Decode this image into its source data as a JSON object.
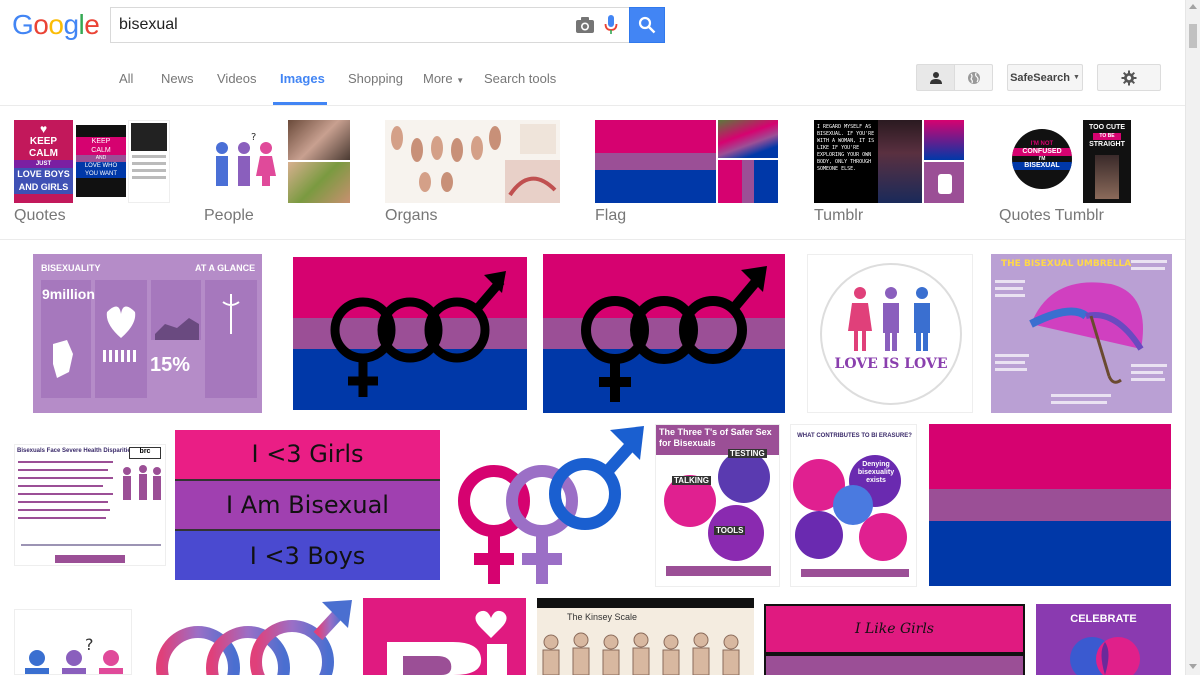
{
  "search": {
    "query": "bisexual"
  },
  "logo": {
    "letters": [
      "G",
      "o",
      "o",
      "g",
      "l",
      "e"
    ],
    "colors": [
      "#4285f4",
      "#ea4335",
      "#fbbc05",
      "#4285f4",
      "#34a853",
      "#ea4335"
    ]
  },
  "nav": {
    "tabs": [
      "All",
      "News",
      "Videos",
      "Images",
      "Shopping",
      "More",
      "Search tools"
    ],
    "active_tab": "Images",
    "safesearch_label": "SafeSearch"
  },
  "related": [
    {
      "label": "Quotes"
    },
    {
      "label": "People"
    },
    {
      "label": "Organs"
    },
    {
      "label": "Flag"
    },
    {
      "label": "Tumblr"
    },
    {
      "label": "Quotes Tumblr"
    }
  ],
  "thumb_text": {
    "keep_calm": [
      "KEEP",
      "CALM",
      "JUST",
      "LOVE BOYS",
      "AND GIRLS"
    ],
    "keep_calm_small": [
      "KEEP",
      "CALM",
      "AND",
      "LOVE WHO",
      "YOU WANT"
    ],
    "not_confused": [
      "I'M NOT",
      "CONFUSED",
      "I'M",
      "BISEXUAL"
    ],
    "too_cute": [
      "TOO CUTE",
      "TO BE",
      "STRAIGHT"
    ],
    "tumblr_quote": "I REGARD MYSELF AS BISEXUAL. IF YOU'RE WITH A WOMAN, IT IS LIKE IF YOU'RE EXPLORING YOUR OWN BODY, ONLY THROUGH SOMEONE ELSE."
  },
  "results": {
    "infographic_title": "BISEXUALITY",
    "infographic_subtitle": "AT A GLANCE",
    "infographic_stat1": "9million",
    "infographic_stat2": "15%",
    "love_is_love": "LOVE IS LOVE",
    "umbrella_title": "THE BISEXUAL UMBRELLA",
    "health_title": "Bisexuals Face Severe Health Disparities",
    "i3_lines": [
      "I <3 Girls",
      "I Am Bisexual",
      "I <3 Boys"
    ],
    "safer_sex_title": "The Three T's of Safer Sex for Bisexuals",
    "safer_sex_labels": [
      "TESTING",
      "TALKING",
      "TOOLS"
    ],
    "erasure_title": "WHAT CONTRIBUTES TO BI ERASURE?",
    "erasure_bubble": "Denying bisexuality exists",
    "kinsey_title": "The Kinsey Scale",
    "i_like_girls": "I Like Girls",
    "celebrate": "CELEBRATE",
    "brc": "brc"
  }
}
